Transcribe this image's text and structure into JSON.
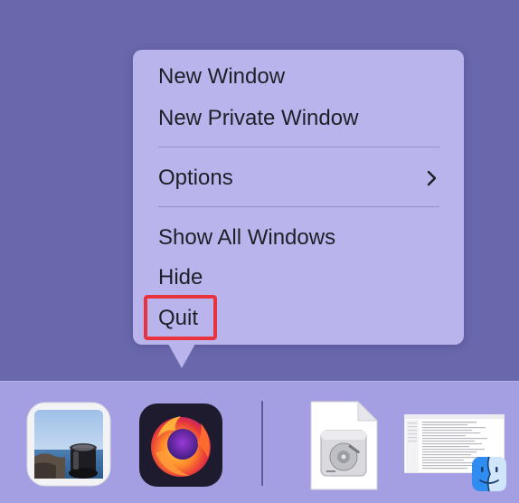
{
  "context_menu": {
    "items": [
      {
        "label": "New Window"
      },
      {
        "label": "New Private Window"
      },
      {
        "label": "Options",
        "icon": "chevron-right-icon"
      },
      {
        "label": "Show All Windows"
      },
      {
        "label": "Hide"
      },
      {
        "label": "Quit",
        "highlighted": true
      }
    ],
    "highlight_color": "#e8323e"
  },
  "dock": {
    "items": [
      {
        "name": "Preview",
        "icon": "preview-icon"
      },
      {
        "name": "Firefox",
        "icon": "firefox-icon"
      },
      {
        "name": "Disk Image",
        "icon": "disk-image-icon"
      },
      {
        "name": "Screenshot",
        "icon": "screenshot-thumbnail"
      },
      {
        "name": "Finder",
        "icon": "finder-icon"
      }
    ]
  },
  "colors": {
    "desktop": "#6a68ad",
    "menu_background": "#b9b5ec",
    "dock_background": "#a39fe2"
  }
}
